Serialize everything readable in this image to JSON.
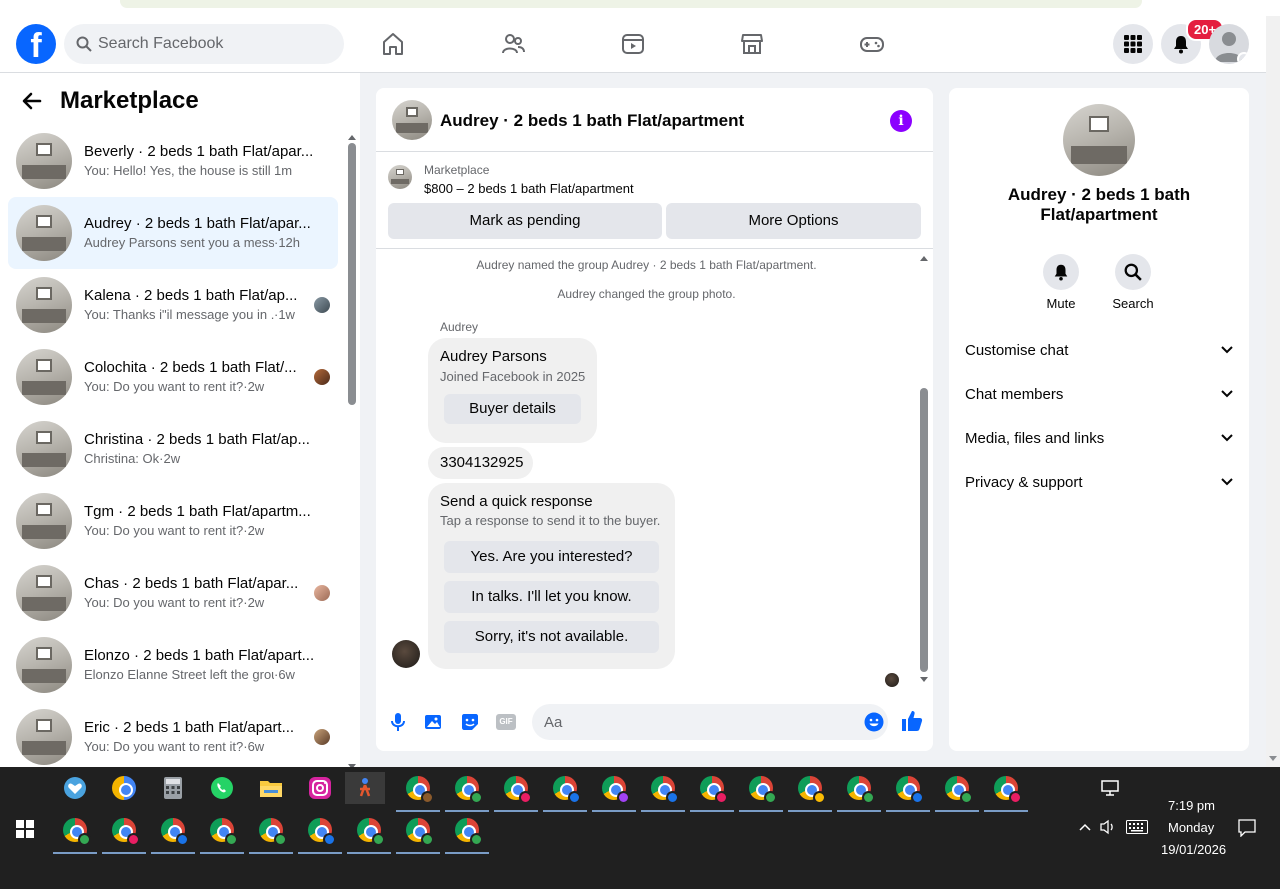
{
  "topbar": {
    "logo": "f",
    "search_placeholder": "Search Facebook",
    "notification_count": "20+",
    "nav_icons": [
      "home-icon",
      "friends-icon",
      "video-icon",
      "marketplace-icon",
      "gaming-icon"
    ]
  },
  "left": {
    "title": "Marketplace",
    "conversations": [
      {
        "title": "Beverly · 2 beds 1 bath Flat/apar...",
        "snippet": "You: Hello! Yes, the house is still av...",
        "time": " 1m"
      },
      {
        "title": "Audrey · 2 beds 1 bath Flat/apar...",
        "snippet": "Audrey Parsons sent you a messa...",
        "time": " ·12h"
      },
      {
        "title": "Kalena · 2 beds 1 bath Flat/ap...",
        "snippet": "You: Thanks i\"il message you in ...",
        "time": " ·1w"
      },
      {
        "title": "Colochita · 2 beds 1 bath Flat/...",
        "snippet": "You: Do you want to rent it?",
        "time": "·2w"
      },
      {
        "title": "Christina · 2 beds 1 bath Flat/ap...",
        "snippet": "Christina: Ok",
        "time": "·2w"
      },
      {
        "title": "Tgm · 2 beds 1 bath Flat/apartm...",
        "snippet": "You: Do you want to rent it?",
        "time": "·2w"
      },
      {
        "title": "Chas · 2 beds 1 bath Flat/apar...",
        "snippet": "You: Do you want to rent it?",
        "time": "·2w"
      },
      {
        "title": "Elonzo · 2 beds 1 bath Flat/apart...",
        "snippet": "Elonzo Elanne Street left the group.",
        "time": "·6w"
      },
      {
        "title": "Eric · 2 beds 1 bath Flat/apart...",
        "snippet": "You: Do you want to rent it?",
        "time": "·6w"
      }
    ]
  },
  "chat": {
    "title": "Audrey · 2 beds 1 bath Flat/apartment",
    "listing_category": "Marketplace",
    "listing_price": "$800 – 2 beds 1 bath Flat/apartment",
    "mark_pending": "Mark as pending",
    "more_options": "More Options",
    "system_1": "Audrey named the group Audrey · 2 beds 1 bath Flat/apartment.",
    "system_2": "Audrey changed the group photo.",
    "sender": "Audrey",
    "buyer_name": "Audrey Parsons",
    "buyer_joined": "Joined Facebook in 2025",
    "buyer_details": "Buyer details",
    "phone": "3304132925",
    "qr_title": "Send a quick response",
    "qr_sub": "Tap a response to send it to the buyer.",
    "qr_options": [
      "Yes. Are you interested?",
      "In talks. I'll let you know.",
      "Sorry, it's not available."
    ],
    "input_placeholder": "Aa",
    "gif_label": "GIF"
  },
  "right": {
    "title": "Audrey · 2 beds 1 bath Flat/apartment",
    "mute": "Mute",
    "search": "Search",
    "rows": [
      "Customise chat",
      "Chat members",
      "Media, files and links",
      "Privacy & support"
    ]
  },
  "taskbar": {
    "time": "7:19 pm",
    "day": "Monday",
    "date": "19/01/2026"
  },
  "colors": {
    "brand": "#0866ff",
    "badge": "#e41e3f",
    "info": "#8b00ff",
    "selected": "#ebf5ff"
  }
}
